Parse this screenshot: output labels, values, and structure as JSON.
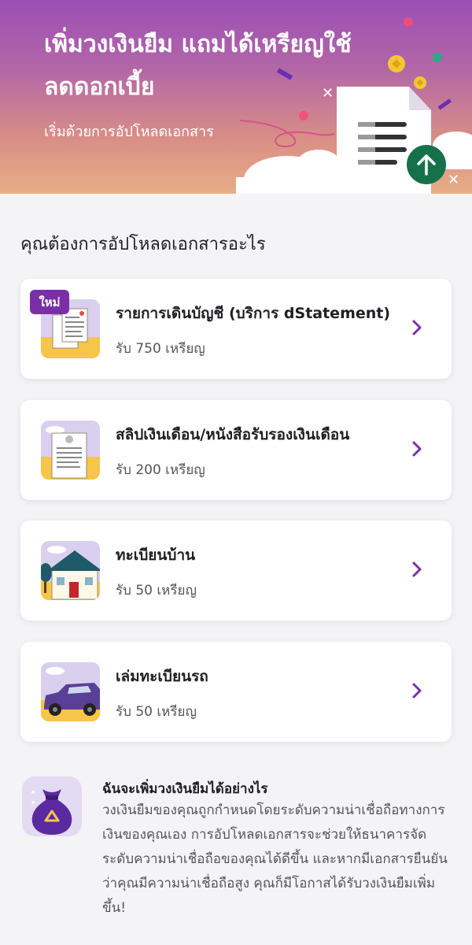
{
  "hero": {
    "title": "เพิ่มวงเงินยืม แถมได้เหรียญใช้ลดดอกเบี้ย",
    "subtitle": "เริ่มด้วยการอัปโหลดเอกสาร"
  },
  "section_title": "คุณต้องการอัปโหลดเอกสารอะไร",
  "documents": [
    {
      "title": "รายการเดินบัญชี (บริการ dStatement)",
      "coins": "รับ 750 เหรียญ",
      "badge": "ใหม่",
      "icon": "bank-statement-icon"
    },
    {
      "title": "สลิปเงินเดือน/หนังสือรับรองเงินเดือน",
      "coins": "รับ 200 เหรียญ",
      "icon": "salary-slip-icon"
    },
    {
      "title": "ทะเบียนบ้าน",
      "coins": "รับ 50 เหรียญ",
      "icon": "house-icon"
    },
    {
      "title": "เล่มทะเบียนรถ",
      "coins": "รับ 50 เหรียญ",
      "icon": "car-icon"
    }
  ],
  "info": {
    "title": "ฉันจะเพิ่มวงเงินยืมได้อย่างไร",
    "body": "วงเงินยืมของคุณถูกกำหนดโดยระดับความน่าเชื่อถือทางการเงินของคุณเอง การอัปโหลดเอกสารจะช่วยให้ธนาคารจัดระดับความน่าเชื่อถือของคุณได้ดีขึ้น และหากมีเอกสารยืนยันว่าคุณมีความน่าเชื่อถือสูง คุณก็มีโอกาสได้รับวงเงินยืมเพิ่มขึ้น!",
    "icon": "money-bag-icon"
  },
  "colors": {
    "accent": "#7a2fa9",
    "upload": "#16714a",
    "card": "#ffffff",
    "background": "#f4f3f6"
  }
}
